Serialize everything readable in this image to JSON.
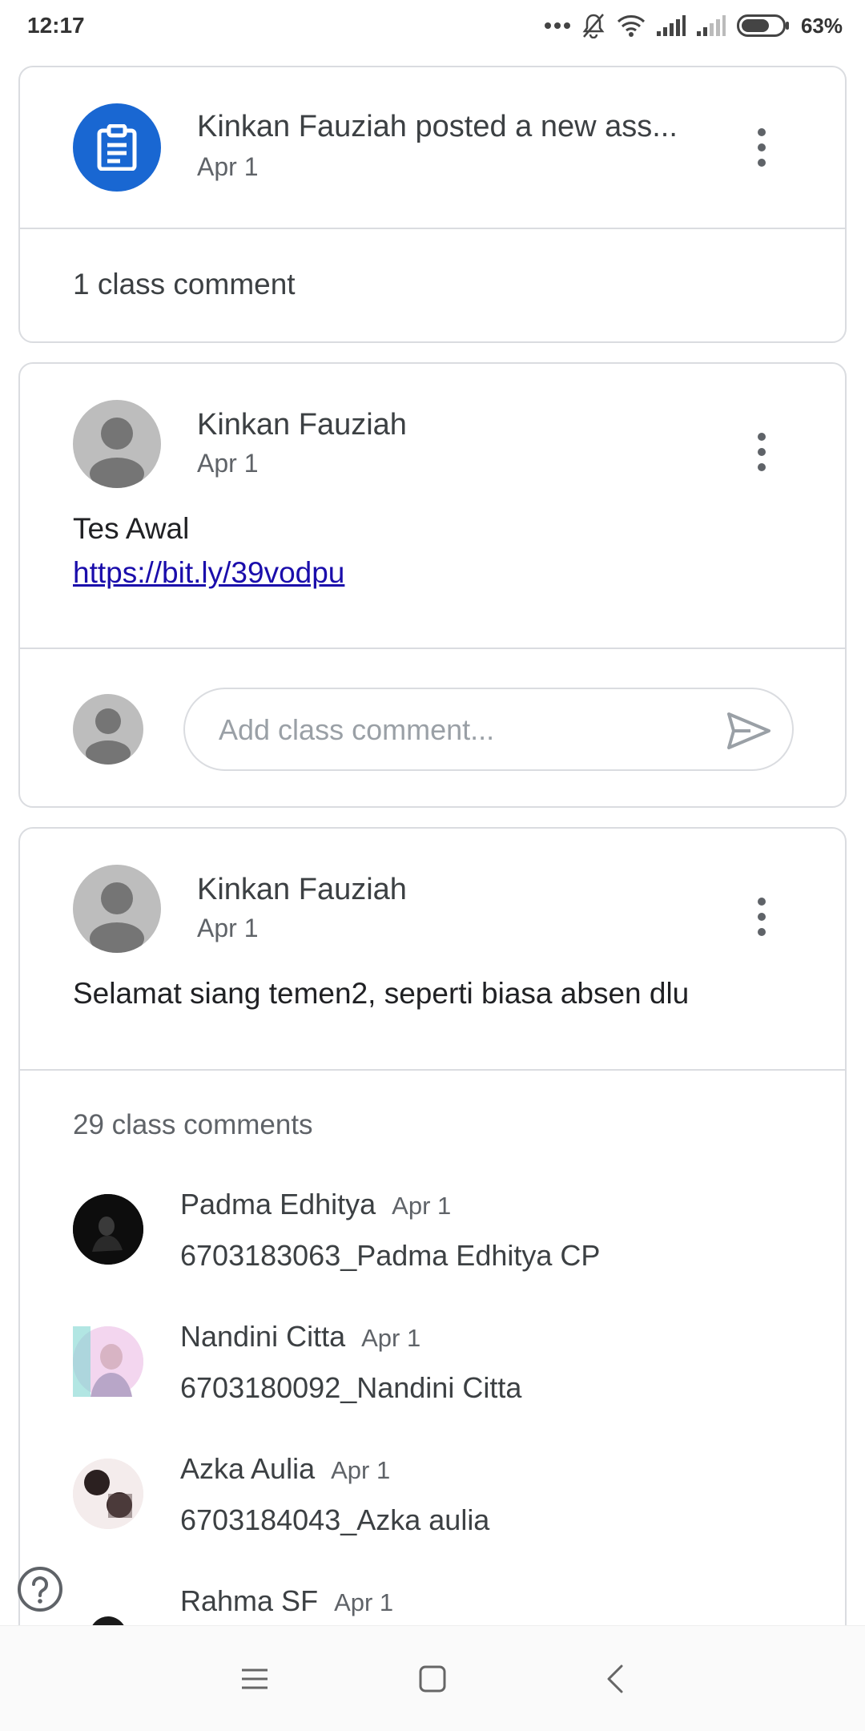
{
  "status_bar": {
    "time": "12:17",
    "battery": "63%",
    "more_icon": "ellipsis-icon",
    "mute_icon": "bell-off-icon",
    "wifi_icon": "wifi-icon",
    "signal_icon": "signal-icon"
  },
  "assignment_card": {
    "icon": "assignment-icon",
    "title": "Kinkan Fauziah posted a new ass...",
    "date": "Apr 1",
    "comment_count": "1 class comment"
  },
  "post_1": {
    "author": "Kinkan Fauziah",
    "date": "Apr 1",
    "body": "Tes Awal",
    "link": "https://bit.ly/39vodpu",
    "comment_placeholder": "Add class comment..."
  },
  "post_2": {
    "author": "Kinkan Fauziah",
    "date": "Apr 1",
    "body": "Selamat siang temen2, seperti biasa absen dlu",
    "comments_header": "29 class comments",
    "comments": [
      {
        "name": "Padma Edhitya",
        "date": "Apr 1",
        "text": "6703183063_Padma Edhitya CP"
      },
      {
        "name": "Nandini Citta",
        "date": "Apr 1",
        "text": "6703180092_Nandini Citta"
      },
      {
        "name": "Azka Aulia",
        "date": "Apr 1",
        "text": "6703184043_Azka aulia"
      },
      {
        "name": "Rahma SF",
        "date": "Apr 1",
        "text": ""
      }
    ]
  },
  "colors": {
    "accent_blue": "#1967d2",
    "link": "#1a0dab",
    "border": "#dadce0"
  },
  "nav": {
    "menu_icon": "menu-icon",
    "home_icon": "square-home-icon",
    "back_icon": "back-chevron-icon"
  }
}
